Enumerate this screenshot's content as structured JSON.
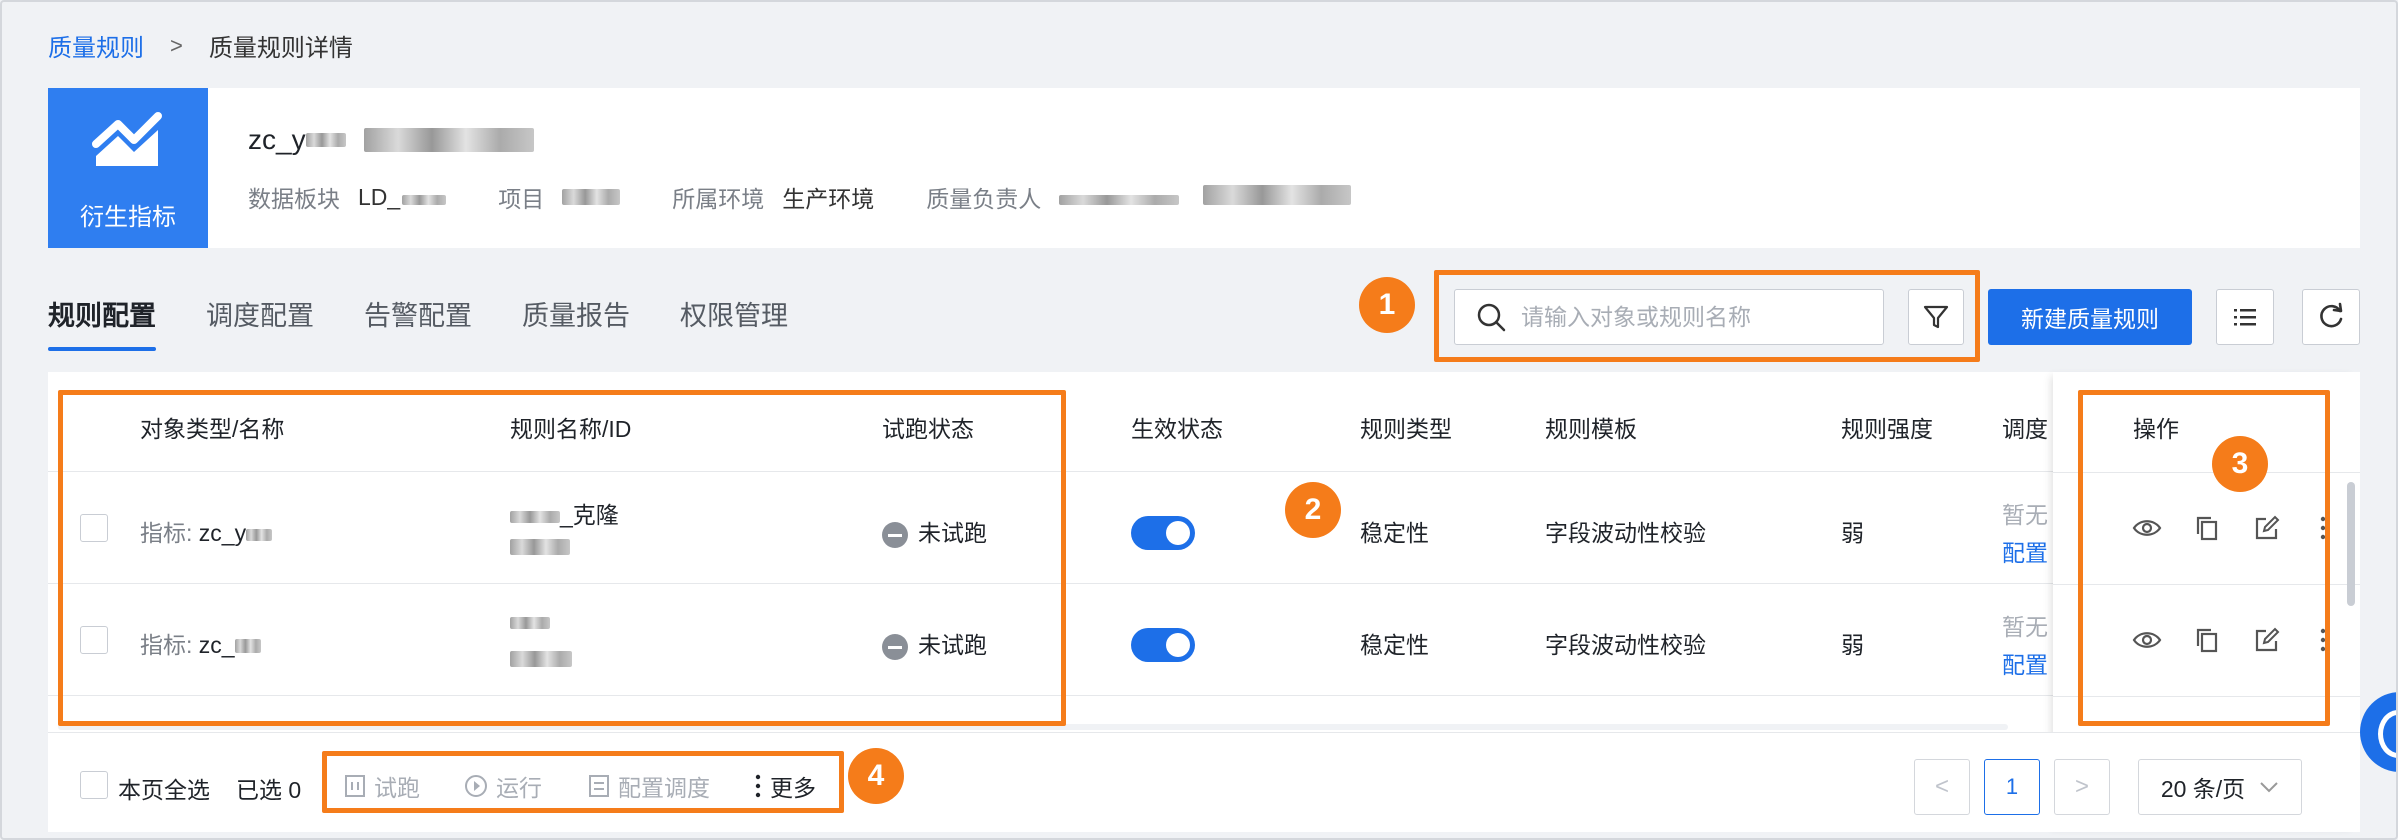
{
  "breadcrumb": {
    "root": "质量规则",
    "separator": ">",
    "current": "质量规则详情"
  },
  "header": {
    "tile_label": "衍生指标",
    "title_prefix": "zc_y",
    "meta": [
      {
        "label": "数据板块",
        "value": "LD_"
      },
      {
        "label": "项目",
        "value": ""
      },
      {
        "label": "所属环境",
        "value": "生产环境"
      },
      {
        "label": "质量负责人",
        "value": ""
      }
    ]
  },
  "tabs": [
    {
      "label": "规则配置",
      "active": true
    },
    {
      "label": "调度配置",
      "active": false
    },
    {
      "label": "告警配置",
      "active": false
    },
    {
      "label": "质量报告",
      "active": false
    },
    {
      "label": "权限管理",
      "active": false
    }
  ],
  "toolbar": {
    "search_placeholder": "请输入对象或规则名称",
    "new_rule_label": "新建质量规则",
    "icons": [
      "search-icon",
      "filter-icon",
      "list-icon",
      "refresh-icon"
    ]
  },
  "table": {
    "columns": {
      "object": "对象类型/名称",
      "rule_name": "规则名称/ID",
      "trial_status": "试跑状态",
      "effect_status": "生效状态",
      "rule_type": "规则类型",
      "rule_template": "规则模板",
      "rule_strength": "规则强度",
      "schedule": "调度",
      "actions": "操作"
    },
    "rows": [
      {
        "object_prefix": "指标:",
        "object_name": "zc_y",
        "rule_name_suffix": "_克隆",
        "rule_id": "",
        "trial_status": "未试跑",
        "effect_on": true,
        "rule_type": "稳定性",
        "rule_template": "字段波动性校验",
        "rule_strength": "弱",
        "schedule_text": "暂无",
        "schedule_link": "配置"
      },
      {
        "object_prefix": "指标:",
        "object_name": "zc_",
        "rule_name_suffix": "",
        "rule_id": "",
        "trial_status": "未试跑",
        "effect_on": true,
        "rule_type": "稳定性",
        "rule_template": "字段波动性校验",
        "rule_strength": "弱",
        "schedule_text": "暂无",
        "schedule_link": "配置"
      }
    ]
  },
  "footer": {
    "select_all_label": "本页全选",
    "selected_count": "已选 0",
    "bulk_actions": [
      {
        "label": "试跑",
        "enabled": false
      },
      {
        "label": "运行",
        "enabled": false
      },
      {
        "label": "配置调度",
        "enabled": false
      },
      {
        "label": "更多",
        "enabled": true
      }
    ],
    "prev": "<",
    "current_page": "1",
    "next": ">",
    "page_size": "20 条/页"
  },
  "annotations": [
    "1",
    "2",
    "3",
    "4"
  ],
  "colors": {
    "primary": "#1d6fe8",
    "annotation": "#f57c1a",
    "tile": "#2f7ef0"
  }
}
